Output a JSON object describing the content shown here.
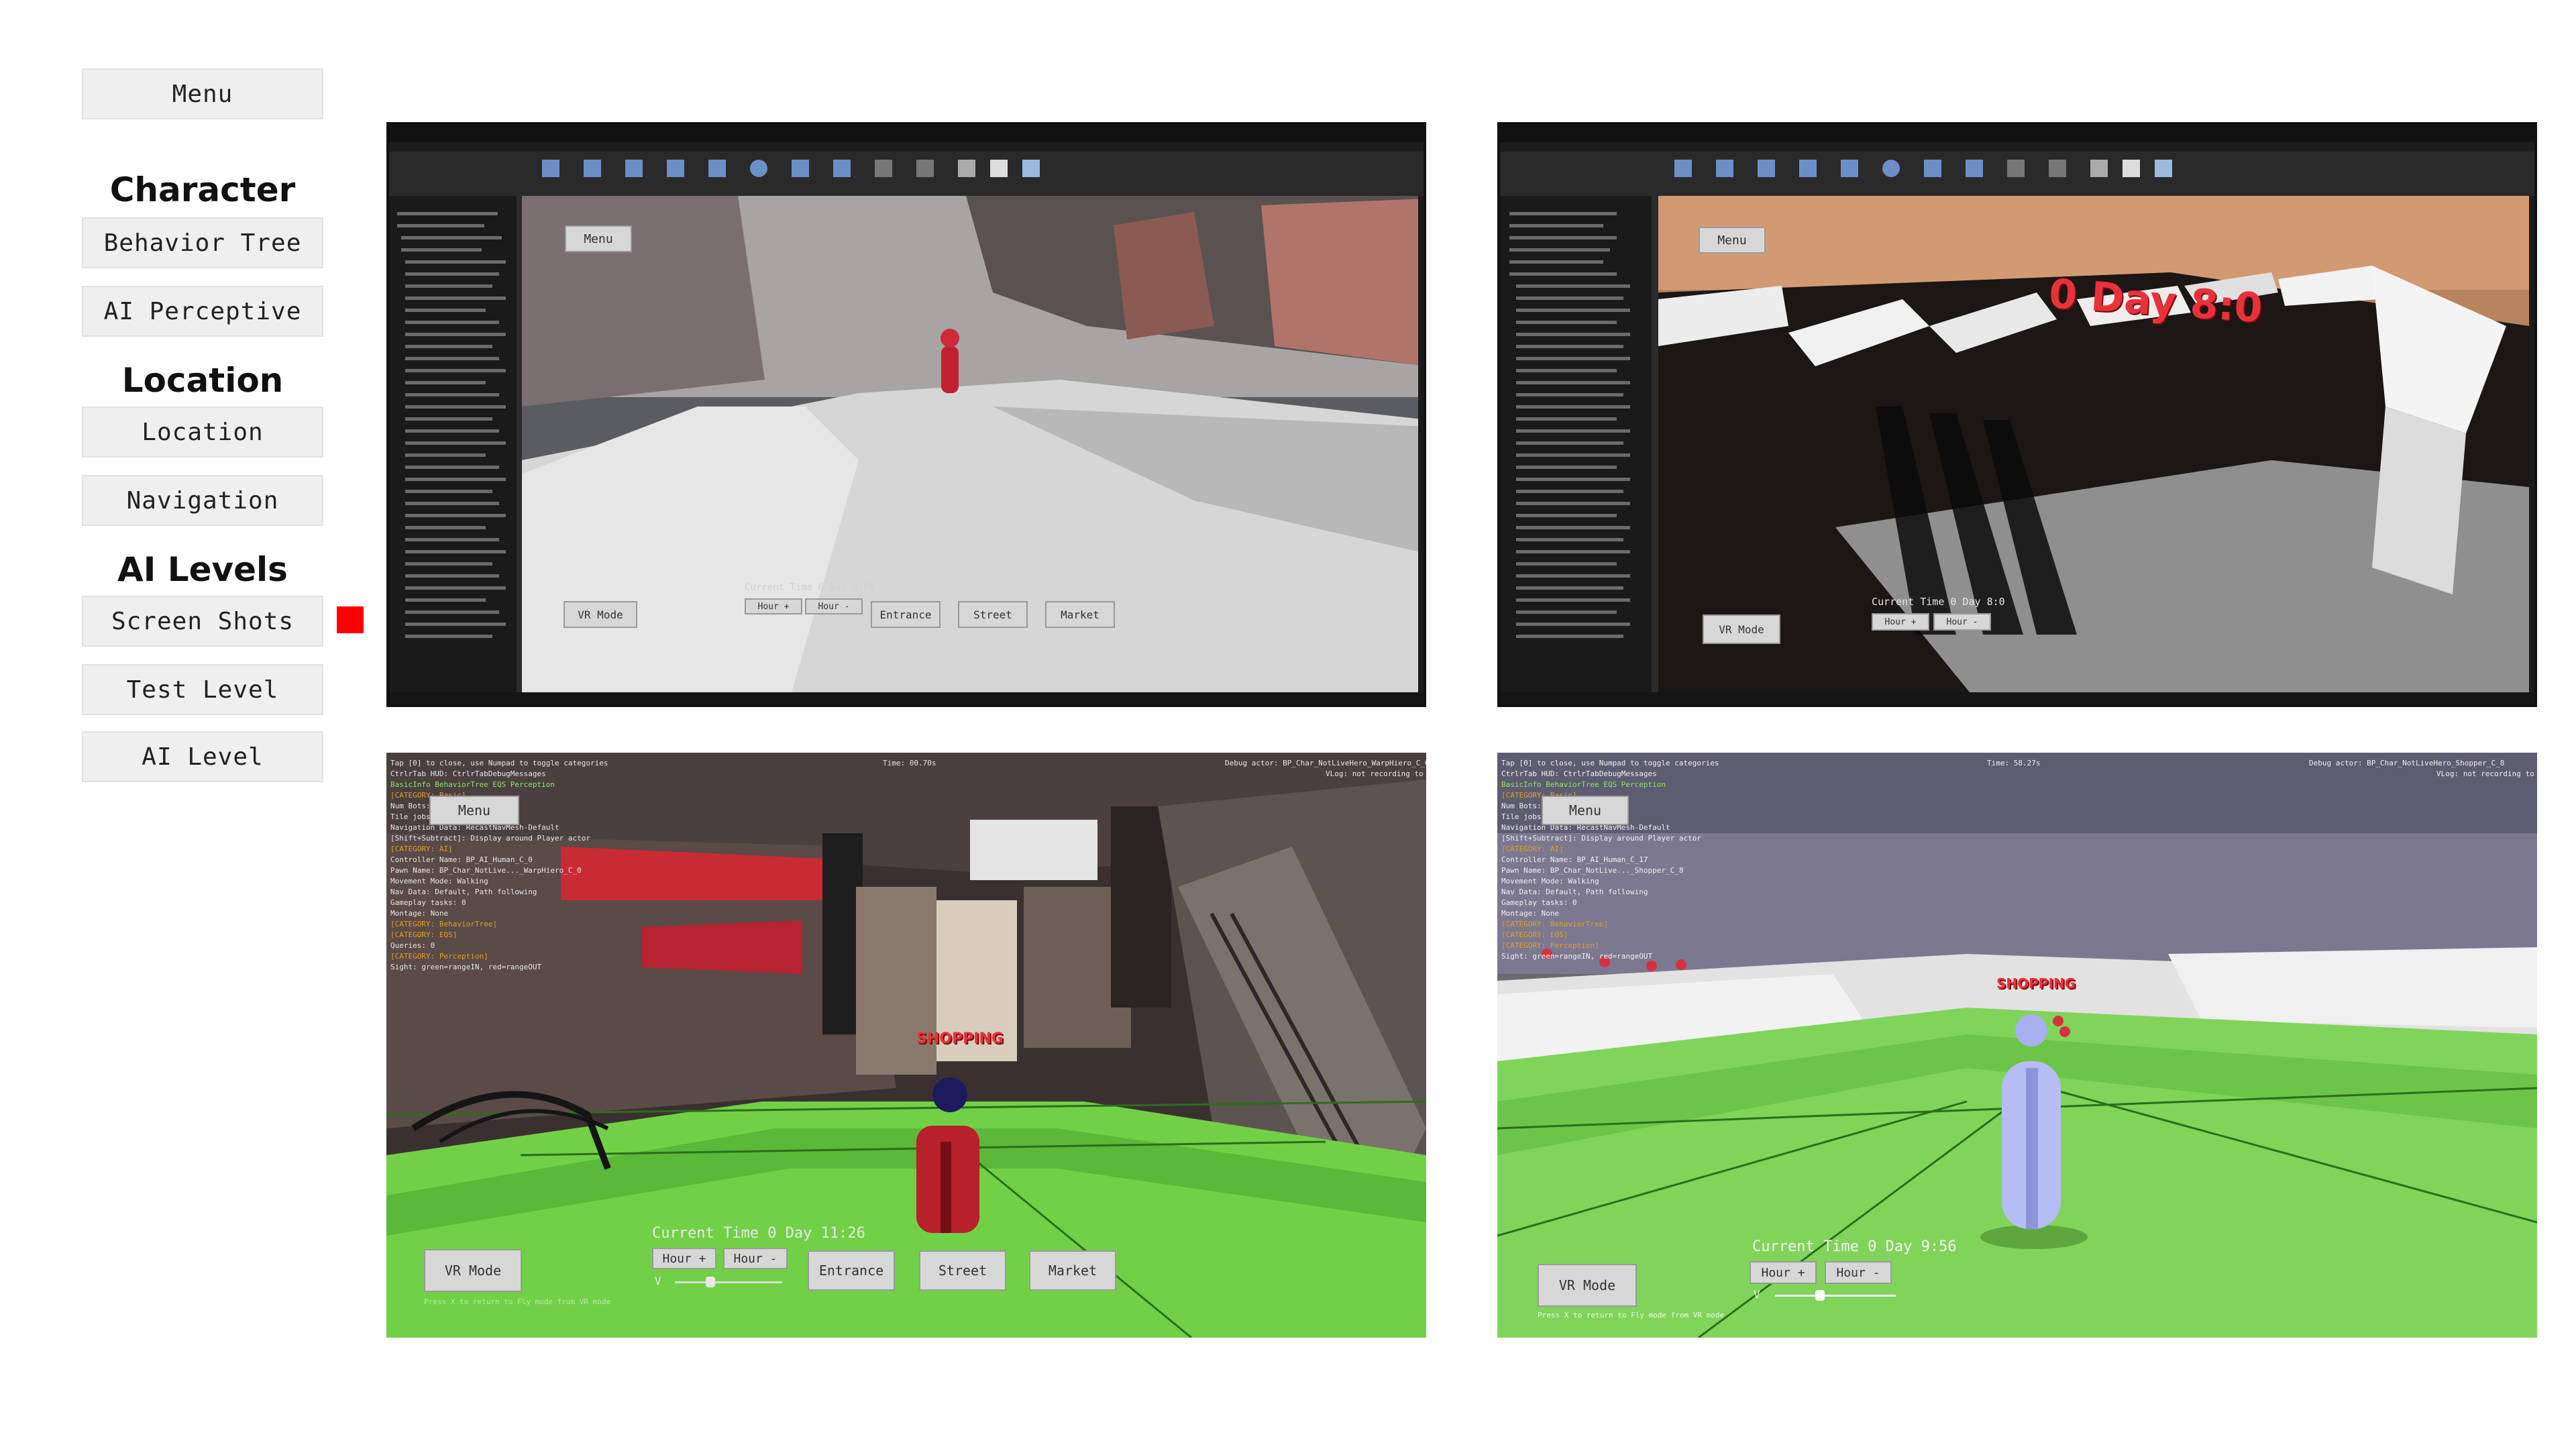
{
  "sidebar": {
    "menu_label": "Menu",
    "sections": [
      {
        "title": "Character",
        "items": [
          "Behavior Tree",
          "AI Perceptive"
        ]
      },
      {
        "title": "Location",
        "items": [
          "Location",
          "Navigation"
        ]
      },
      {
        "title": "AI Levels",
        "items": [
          "Screen Shots",
          "Test Level",
          "AI Level"
        ]
      }
    ],
    "active_item": "Screen Shots",
    "active_marker_color": "#ff0000"
  },
  "screenshots": {
    "top_left": {
      "menu": "Menu",
      "vr_mode": "VR Mode",
      "time": "Current Time 0 Day 9:56",
      "hour_plus": "Hour +",
      "hour_minus": "Hour -",
      "entrance": "Entrance",
      "street": "Street",
      "market": "Market"
    },
    "top_right": {
      "menu": "Menu",
      "big_time": "0 Day 8:0",
      "time": "Current Time 0 Day 8:0",
      "hour_plus": "Hour +",
      "hour_minus": "Hour -",
      "vr_mode": "VR Mode"
    },
    "bottom_left": {
      "menu": "Menu",
      "time": "Current Time 0 Day 11:26",
      "hour_plus": "Hour +",
      "hour_minus": "Hour -",
      "v_label": "V",
      "entrance": "Entrance",
      "street": "Street",
      "market": "Market",
      "vr_mode": "VR Mode",
      "hint": "Press X to return to Fly mode from VR mode",
      "debug_lines": [
        "Tap [0] to close, use Numpad to toggle categories",
        "CtrlrTab HUD: CtrlrTabDebugMessages",
        "BasicInfo  BehaviorTree  EQS  Perception",
        "[CATEGORY: Basic]",
        "Num Bots: 1",
        "Tile jobs: 0",
        "Navigation Data: RecastNavMesh-Default",
        "[Shift+Subtract]: Display around Player actor",
        "[CATEGORY: AI]",
        "Controller Name: BP_AI_Human_C_0",
        "Pawn Name: BP_Char_NotLive..._WarpHiero_C_0",
        "Movement Mode: Walking",
        "Nav Data: Default, Path following",
        "Gameplay tasks: 0",
        "Montage: None",
        "[CATEGORY: BehaviorTree]",
        "[CATEGORY: EQS]",
        "Queries: 0",
        "[CATEGORY: Perception]",
        "Sight: green=rangeIN, red=rangeOUT"
      ],
      "debug_actor": "Debug actor: BP_Char_NotLiveHero_WarpHiero_C_0",
      "vlog": "VLog: not recording to file",
      "time_top": "Time: 00.70s",
      "tag": "SHOPPING"
    },
    "bottom_right": {
      "menu": "Menu",
      "time": "Current Time 0 Day 9:56",
      "hour_plus": "Hour +",
      "hour_minus": "Hour -",
      "v_label": "V",
      "vr_mode": "VR Mode",
      "hint": "Press X to return to Fly mode from VR mode",
      "debug_lines": [
        "Tap [0] to close, use Numpad to toggle categories",
        "CtrlrTab HUD: CtrlrTabDebugMessages",
        "BasicInfo  BehaviorTree  EQS  Perception",
        "[CATEGORY: Basic]",
        "Num Bots: 1",
        "Tile jobs: 0",
        "Navigation Data: RecastNavMesh-Default",
        "[Shift+Subtract]: Display around Player actor",
        "[CATEGORY: AI]",
        "Controller Name: BP_AI_Human_C_17",
        "Pawn Name: BP_Char_NotLive..._Shopper_C_8",
        "Movement Mode: Walking",
        "Nav Data: Default, Path following",
        "Gameplay tasks: 0",
        "Montage: None",
        "[CATEGORY: BehaviorTree]",
        "[CATEGORY: EQS]",
        "[CATEGORY: Perception]",
        "Sight: green=rangeIN, red=rangeOUT"
      ],
      "debug_actor": "Debug actor: BP_Char_NotLiveHero_Shopper_C_8",
      "vlog": "VLog: not recording to file",
      "time_top": "Time: 58.27s",
      "tag": "SHOPPING"
    }
  },
  "colors": {
    "editor_bg": "#262626",
    "editor_dark": "#151515",
    "ground_green": "#7ed35a",
    "sky_dusk": "#c07a52",
    "red_text": "#e8323a"
  }
}
